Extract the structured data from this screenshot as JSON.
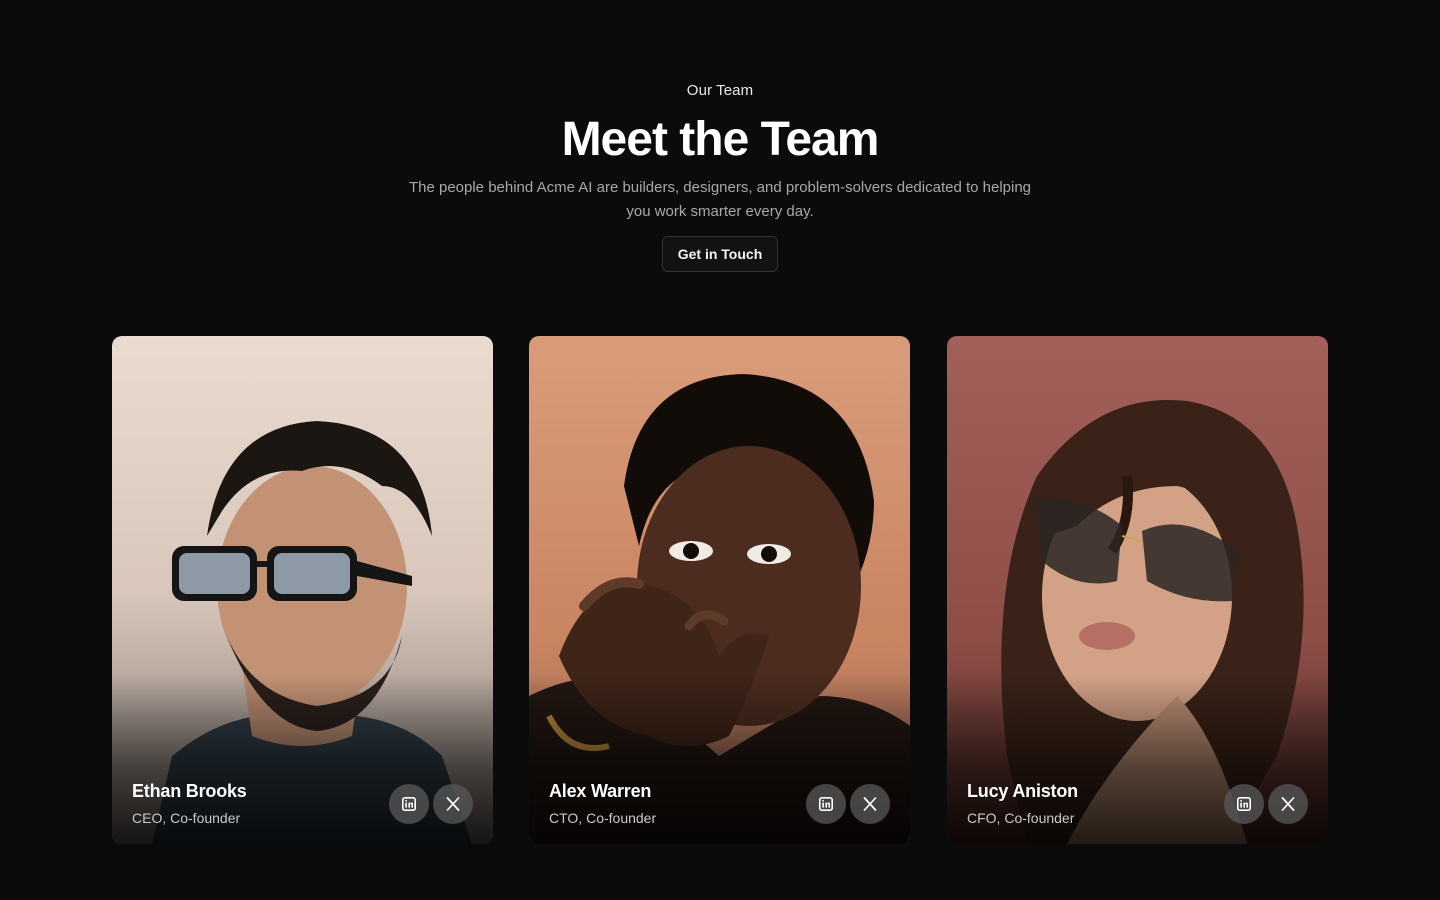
{
  "header": {
    "eyebrow": "Our Team",
    "title": "Meet the Team",
    "subtitle": "The people behind Acme AI are builders, designers, and problem-solvers dedicated to helping you work smarter every day.",
    "cta_label": "Get in Touch"
  },
  "team": [
    {
      "name": "Ethan Brooks",
      "role": "CEO, Co-founder",
      "social": [
        "linkedin-icon",
        "x-icon"
      ]
    },
    {
      "name": "Alex Warren",
      "role": "CTO, Co-founder",
      "social": [
        "linkedin-icon",
        "x-icon"
      ]
    },
    {
      "name": "Lucy Aniston",
      "role": "CFO, Co-founder",
      "social": [
        "linkedin-icon",
        "x-icon"
      ]
    }
  ],
  "colors": {
    "background": "#0b0b0b",
    "card_1_backdrop": "#e6d6cb",
    "card_2_backdrop": "#d99a78",
    "card_3_backdrop": "#9c5750"
  }
}
